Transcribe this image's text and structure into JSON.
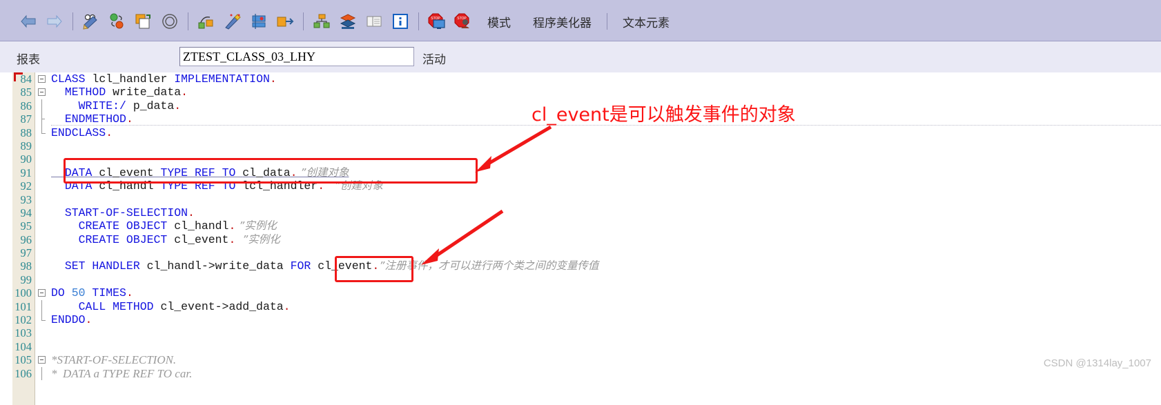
{
  "toolbar": {
    "icons": [
      {
        "name": "back-arrow-icon",
        "glyph": "⇦"
      },
      {
        "name": "forward-arrow-icon",
        "glyph": "⇨"
      },
      {
        "name": "check-syntax-icon",
        "glyph": "✎"
      },
      {
        "name": "activate-icon",
        "glyph": "⚫"
      },
      {
        "name": "copy-object-icon",
        "glyph": "❐"
      },
      {
        "name": "where-used-icon",
        "glyph": "◎"
      },
      {
        "name": "display-object-list-icon",
        "glyph": "▣"
      },
      {
        "name": "pretty-printer-magic-icon",
        "glyph": "✦"
      },
      {
        "name": "debug-icon",
        "glyph": "▤"
      },
      {
        "name": "execute-icon",
        "glyph": "↗"
      },
      {
        "name": "object-navigator-icon",
        "glyph": "⑂"
      },
      {
        "name": "stack-icon",
        "glyph": "☰"
      },
      {
        "name": "list-icon",
        "glyph": "▦"
      },
      {
        "name": "info-icon",
        "glyph": "i"
      },
      {
        "name": "breakpoint-session-icon",
        "glyph": "⛔"
      },
      {
        "name": "breakpoint-user-icon",
        "glyph": "⛔"
      }
    ],
    "mode_label": "模式",
    "pretty_printer_label": "程序美化器",
    "text_elements_label": "文本元素"
  },
  "header": {
    "report_label": "报表",
    "report_name": "ZTEST_CLASS_03_LHY",
    "status_label": "活动"
  },
  "annotation": {
    "text": "cl_event是可以触发事件的对象",
    "color": "#fc1515"
  },
  "highlight_boxes": [
    {
      "name": "redbox-line-91",
      "target": "DATA cl_event TYPE REF TO cl_data."
    },
    {
      "name": "redbox-line-98-cl-event",
      "target": "cl_event."
    }
  ],
  "code": {
    "lines": [
      {
        "num": "84",
        "fold": "open",
        "segs": [
          {
            "t": "CLASS ",
            "c": "kw"
          },
          {
            "t": "lcl_handler ",
            "c": "id"
          },
          {
            "t": "IMPLEMENTATION",
            "c": "kw"
          },
          {
            "t": ".",
            "c": "pt"
          }
        ]
      },
      {
        "num": "85",
        "fold": "open2",
        "indent": 2,
        "segs": [
          {
            "t": "METHOD ",
            "c": "kw"
          },
          {
            "t": "write_data",
            "c": "id"
          },
          {
            "t": ".",
            "c": "pt"
          }
        ]
      },
      {
        "num": "86",
        "fold": "bar",
        "indent": 4,
        "segs": [
          {
            "t": "WRITE:/ ",
            "c": "kw"
          },
          {
            "t": "p_data",
            "c": "id"
          },
          {
            "t": ".",
            "c": "pt"
          }
        ]
      },
      {
        "num": "87",
        "fold": "mid",
        "indent": 2,
        "segs": [
          {
            "t": "ENDMETHOD",
            "c": "kw"
          },
          {
            "t": ".",
            "c": "pt"
          }
        ]
      },
      {
        "num": "88",
        "fold": "end",
        "indent": 0,
        "segs": [
          {
            "t": "ENDCLASS",
            "c": "kw"
          },
          {
            "t": ".",
            "c": "pt"
          }
        ]
      },
      {
        "num": "89",
        "fold": "none",
        "segs": []
      },
      {
        "num": "90",
        "fold": "none",
        "segs": []
      },
      {
        "num": "91",
        "fold": "none",
        "indent": 2,
        "underline": true,
        "segs": [
          {
            "t": "DATA ",
            "c": "kw"
          },
          {
            "t": "cl_event ",
            "c": "id"
          },
          {
            "t": "TYPE REF TO ",
            "c": "kw"
          },
          {
            "t": "cl_data",
            "c": "id"
          },
          {
            "t": ".",
            "c": "pt"
          },
          {
            "t": " ”创建对象",
            "c": "cmt-cn"
          }
        ]
      },
      {
        "num": "92",
        "fold": "none",
        "indent": 2,
        "segs": [
          {
            "t": "DATA ",
            "c": "kw"
          },
          {
            "t": "cl_handl ",
            "c": "id"
          },
          {
            "t": "TYPE REF TO ",
            "c": "kw"
          },
          {
            "t": "lcl_handler",
            "c": "id"
          },
          {
            "t": ".",
            "c": "pt"
          },
          {
            "t": "   ”创建对象",
            "c": "cmt-cn"
          }
        ]
      },
      {
        "num": "93",
        "fold": "none",
        "segs": []
      },
      {
        "num": "94",
        "fold": "none",
        "indent": 2,
        "segs": [
          {
            "t": "START-OF-SELECTION",
            "c": "kw"
          },
          {
            "t": ".",
            "c": "pt"
          }
        ]
      },
      {
        "num": "95",
        "fold": "none",
        "indent": 4,
        "segs": [
          {
            "t": "CREATE OBJECT ",
            "c": "kw"
          },
          {
            "t": "cl_handl",
            "c": "id"
          },
          {
            "t": ".",
            "c": "pt"
          },
          {
            "t": " ”实例化",
            "c": "cmt-cn"
          }
        ]
      },
      {
        "num": "96",
        "fold": "none",
        "indent": 4,
        "segs": [
          {
            "t": "CREATE OBJECT ",
            "c": "kw"
          },
          {
            "t": "cl_event",
            "c": "id"
          },
          {
            "t": ".",
            "c": "pt"
          },
          {
            "t": "  ”实例化",
            "c": "cmt-cn"
          }
        ]
      },
      {
        "num": "97",
        "fold": "none",
        "segs": []
      },
      {
        "num": "98",
        "fold": "none",
        "indent": 2,
        "segs": [
          {
            "t": "SET HANDLER ",
            "c": "kw"
          },
          {
            "t": "cl_handl->write_data ",
            "c": "id"
          },
          {
            "t": "FOR ",
            "c": "kw"
          },
          {
            "t": "cl_event",
            "c": "id"
          },
          {
            "t": ".",
            "c": "pt"
          },
          {
            "t": "”注册事件，才可以进行两个类之间的变量传值",
            "c": "cmt-cn"
          }
        ]
      },
      {
        "num": "99",
        "fold": "none",
        "segs": []
      },
      {
        "num": "100",
        "fold": "open",
        "segs": [
          {
            "t": "DO ",
            "c": "kw"
          },
          {
            "t": "50",
            "c": "num"
          },
          {
            "t": " TIMES",
            "c": "kw"
          },
          {
            "t": ".",
            "c": "pt"
          }
        ]
      },
      {
        "num": "101",
        "fold": "bar",
        "indent": 4,
        "segs": [
          {
            "t": "CALL METHOD ",
            "c": "kw"
          },
          {
            "t": "cl_event->add_data",
            "c": "id"
          },
          {
            "t": ".",
            "c": "pt"
          }
        ]
      },
      {
        "num": "102",
        "fold": "end",
        "indent": 0,
        "segs": [
          {
            "t": "ENDDO",
            "c": "kw"
          },
          {
            "t": ".",
            "c": "pt"
          }
        ]
      },
      {
        "num": "103",
        "fold": "none",
        "segs": []
      },
      {
        "num": "104",
        "fold": "none",
        "segs": []
      },
      {
        "num": "105",
        "fold": "open",
        "segs": [
          {
            "t": "*START-OF-SELECTION.",
            "c": "cmt"
          }
        ]
      },
      {
        "num": "106",
        "fold": "bar",
        "segs": [
          {
            "t": "*  DATA a TYPE REF TO car.",
            "c": "cmt"
          }
        ]
      }
    ]
  },
  "watermark": "CSDN @1314lay_1007"
}
